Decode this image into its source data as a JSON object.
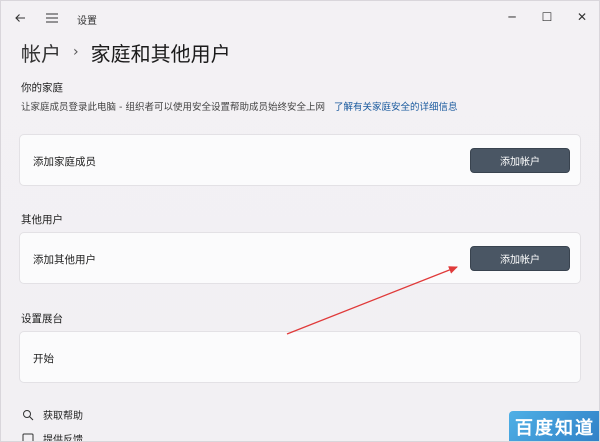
{
  "window": {
    "title": "设置",
    "back_icon": "back-arrow-icon",
    "menu_icon": "hamburger-menu-icon",
    "controls": {
      "minimize": "─",
      "maximize": "☐",
      "close": "✕"
    }
  },
  "header": {
    "breadcrumb_parent": "帐户",
    "separator": "›",
    "title": "家庭和其他用户"
  },
  "family": {
    "heading": "你的家庭",
    "description": "让家庭成员登录此电脑 - 组织者可以使用安全设置帮助成员始终安全上网",
    "learn_more_link": "了解有关家庭安全的详细信息",
    "card_label": "添加家庭成员",
    "button_label": "添加帐户"
  },
  "other_users": {
    "heading": "其他用户",
    "card_label": "添加其他用户",
    "button_label": "添加帐户"
  },
  "kiosk": {
    "heading": "设置展台",
    "card_label": "开始"
  },
  "footer": {
    "help_label": "获取帮助",
    "feedback_label": "提供反馈"
  },
  "watermark": {
    "text": "百度知道"
  },
  "colors": {
    "button_bg": "#4a5664",
    "link": "#1a5a9e",
    "arrow": "#e03a3a",
    "watermark_bg": "#2f7fc6"
  }
}
